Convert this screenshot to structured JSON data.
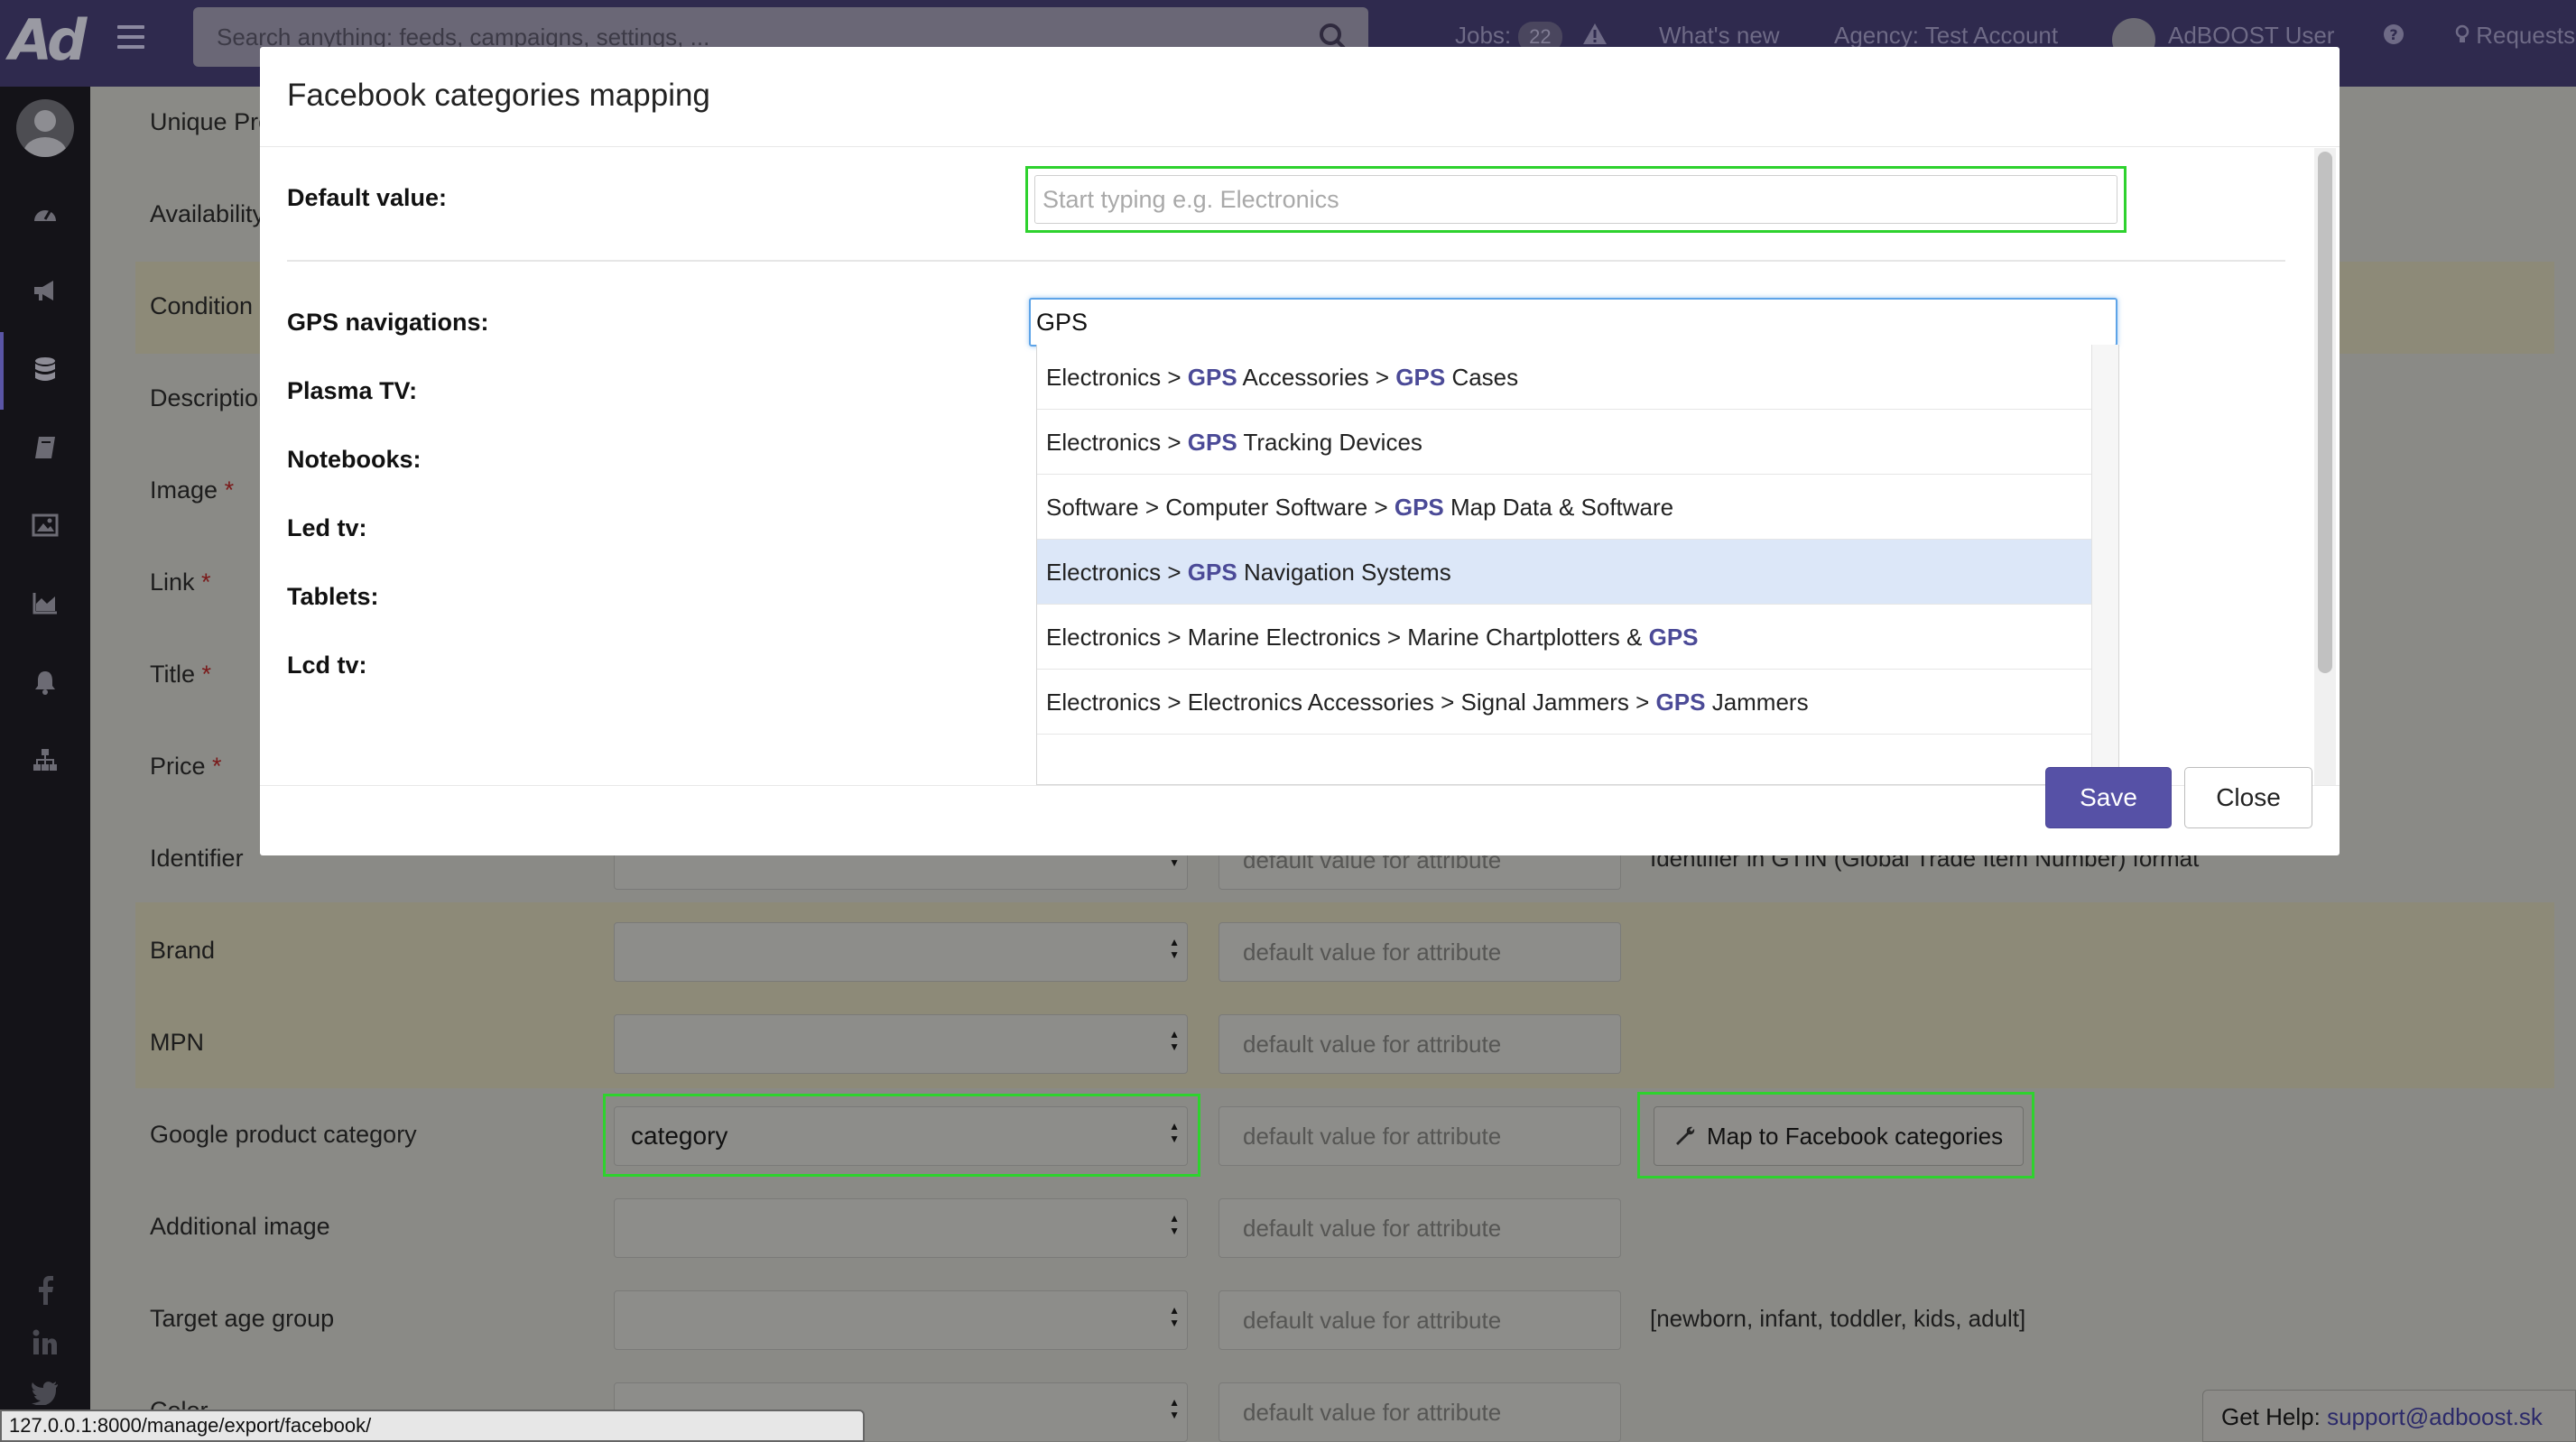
{
  "topbar": {
    "logo": "Ad",
    "search_placeholder": "Search anything: feeds, campaigns, settings, ...",
    "jobs_label": "Jobs:",
    "jobs_count": "22",
    "whats_new": "What's new",
    "agency": "Agency: Test Account",
    "user": "AdBOOST User",
    "requests": "Requests"
  },
  "sidebar": {
    "icons": [
      "dashboard-icon",
      "megaphone-icon",
      "database-icon",
      "book-icon",
      "image-icon",
      "area-chart-icon",
      "bell-icon",
      "sitemap-icon",
      "facebook-icon",
      "linkedin-icon",
      "twitter-icon"
    ]
  },
  "background": {
    "rows": [
      {
        "label": "Unique Pro"
      },
      {
        "label": "Availability"
      },
      {
        "label": "Condition"
      },
      {
        "label": "Description"
      },
      {
        "label": "Image",
        "required": "*"
      },
      {
        "label": "Link",
        "required": "*"
      },
      {
        "label": "Title",
        "required": "*"
      },
      {
        "label": "Price",
        "required": "*"
      },
      {
        "label": "Identifier",
        "default_placeholder": "default value for attribute",
        "hint": "Identifier in GTIN (Global Trade Item Number) format"
      },
      {
        "label": "Brand",
        "default_placeholder": "default value for attribute"
      },
      {
        "label": "MPN",
        "default_placeholder": "default value for attribute"
      },
      {
        "label": "Google product category",
        "select_value": "category",
        "default_placeholder": "default value for attribute",
        "button": "Map to Facebook categories"
      },
      {
        "label": "Additional image",
        "default_placeholder": "default value for attribute"
      },
      {
        "label": "Target age group",
        "default_placeholder": "default value for attribute",
        "hint": "[newborn, infant, toddler, kids, adult]"
      },
      {
        "label": "Color",
        "default_placeholder": "default value for attribute"
      }
    ],
    "status_url": "127.0.0.1:8000/manage/export/facebook/",
    "help_label": "Get Help:",
    "help_email": "support@adboost.sk"
  },
  "modal": {
    "title": "Facebook categories mapping",
    "default_label": "Default value:",
    "default_placeholder": "Start typing e.g. Electronics",
    "fields": [
      {
        "label": "GPS navigations:",
        "value": "GPS"
      },
      {
        "label": "Plasma TV:"
      },
      {
        "label": "Notebooks:"
      },
      {
        "label": "Led tv:"
      },
      {
        "label": "Tablets:"
      },
      {
        "label": "Lcd tv:"
      }
    ],
    "suggestions": [
      {
        "parts": [
          "Electronics > ",
          "GPS",
          " Accessories > ",
          "GPS",
          " Cases"
        ]
      },
      {
        "parts": [
          "Electronics > ",
          "GPS",
          " Tracking Devices"
        ]
      },
      {
        "parts": [
          "Software > Computer Software > ",
          "GPS",
          " Map Data & Software"
        ]
      },
      {
        "parts": [
          "Electronics > ",
          "GPS",
          " Navigation Systems"
        ],
        "active": true
      },
      {
        "parts": [
          "Electronics > Marine Electronics > Marine Chartplotters & ",
          "GPS"
        ]
      },
      {
        "parts": [
          "Electronics > Electronics Accessories > Signal Jammers > ",
          "GPS",
          " Jammers"
        ]
      }
    ],
    "save_label": "Save",
    "close_label": "Close"
  },
  "colors": {
    "accent": "#5651a6",
    "highlight_green": "#2ed22e",
    "navbar": "#2f2a4e",
    "sidebar": "#141318",
    "active_suggestion": "#dce7f8",
    "focus_border": "#5ea4e8"
  }
}
